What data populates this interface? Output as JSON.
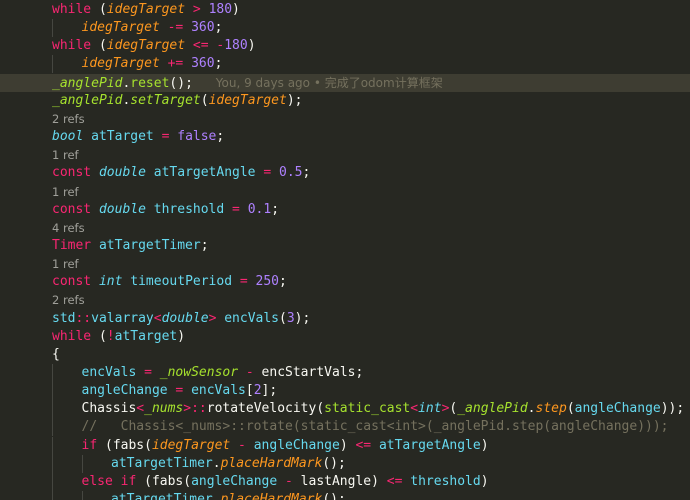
{
  "editor": {
    "lines": [
      {
        "indent": 0,
        "tokens": [
          [
            "kw",
            "while"
          ],
          [
            "p",
            " ("
          ],
          [
            "param",
            "idegTarget"
          ],
          [
            "op",
            " > "
          ],
          [
            "num",
            "180"
          ],
          [
            "p",
            ")"
          ]
        ]
      },
      {
        "indent": 1,
        "tokens": [
          [
            "param",
            "idegTarget"
          ],
          [
            "op",
            " -= "
          ],
          [
            "num",
            "360"
          ],
          [
            "p",
            ";"
          ]
        ]
      },
      {
        "indent": 0,
        "tokens": [
          [
            "kw",
            "while"
          ],
          [
            "p",
            " ("
          ],
          [
            "param",
            "idegTarget"
          ],
          [
            "op",
            " <= "
          ],
          [
            "op",
            "-"
          ],
          [
            "num",
            "180"
          ],
          [
            "p",
            ")"
          ]
        ]
      },
      {
        "indent": 1,
        "tokens": [
          [
            "param",
            "idegTarget"
          ],
          [
            "op",
            " += "
          ],
          [
            "num",
            "360"
          ],
          [
            "p",
            ";"
          ]
        ]
      },
      {
        "indent": 0,
        "current": true,
        "blame": "You, 9 days ago • 完成了odom计算框架",
        "tokens": [
          [
            "mem",
            "_anglePid"
          ],
          [
            "p",
            "."
          ],
          [
            "fn",
            "reset"
          ],
          [
            "p",
            "();"
          ]
        ]
      },
      {
        "indent": 0,
        "tokens": [
          [
            "mem",
            "_anglePid"
          ],
          [
            "p",
            "."
          ],
          [
            "mem",
            "setTarget"
          ],
          [
            "p",
            "("
          ],
          [
            "param",
            "idegTarget"
          ],
          [
            "p",
            ");"
          ]
        ]
      },
      {
        "indent": 0,
        "refs": "2 refs"
      },
      {
        "indent": 0,
        "tokens": [
          [
            "type",
            "bool"
          ],
          [
            "p",
            " "
          ],
          [
            "id",
            "atTarget"
          ],
          [
            "op",
            " = "
          ],
          [
            "num",
            "false"
          ],
          [
            "p",
            ";"
          ]
        ]
      },
      {
        "indent": 0,
        "refs": "1 ref"
      },
      {
        "indent": 0,
        "tokens": [
          [
            "kw",
            "const"
          ],
          [
            "p",
            " "
          ],
          [
            "type",
            "double"
          ],
          [
            "p",
            " "
          ],
          [
            "id",
            "atTargetAngle"
          ],
          [
            "op",
            " = "
          ],
          [
            "num",
            "0.5"
          ],
          [
            "p",
            ";"
          ]
        ]
      },
      {
        "indent": 0,
        "refs": "1 ref"
      },
      {
        "indent": 0,
        "tokens": [
          [
            "kw",
            "const"
          ],
          [
            "p",
            " "
          ],
          [
            "type",
            "double"
          ],
          [
            "p",
            " "
          ],
          [
            "id",
            "threshold"
          ],
          [
            "op",
            " = "
          ],
          [
            "num",
            "0.1"
          ],
          [
            "p",
            ";"
          ]
        ]
      },
      {
        "indent": 0,
        "refs": "4 refs"
      },
      {
        "indent": 0,
        "tokens": [
          [
            "kw",
            "Timer"
          ],
          [
            "p",
            " "
          ],
          [
            "id",
            "atTargetTimer"
          ],
          [
            "p",
            ";"
          ]
        ]
      },
      {
        "indent": 0,
        "refs": "1 ref"
      },
      {
        "indent": 0,
        "tokens": [
          [
            "kw",
            "const"
          ],
          [
            "p",
            " "
          ],
          [
            "type",
            "int"
          ],
          [
            "p",
            " "
          ],
          [
            "id",
            "timeoutPeriod"
          ],
          [
            "op",
            " = "
          ],
          [
            "num",
            "250"
          ],
          [
            "p",
            ";"
          ]
        ]
      },
      {
        "indent": 0,
        "refs": "2 refs"
      },
      {
        "indent": 0,
        "tokens": [
          [
            "cls",
            "std"
          ],
          [
            "op",
            "::"
          ],
          [
            "cls",
            "valarray"
          ],
          [
            "op",
            "<"
          ],
          [
            "type",
            "double"
          ],
          [
            "op",
            ">"
          ],
          [
            "p",
            " "
          ],
          [
            "id",
            "encVals"
          ],
          [
            "p",
            "("
          ],
          [
            "num",
            "3"
          ],
          [
            "p",
            ");"
          ]
        ]
      },
      {
        "indent": 0,
        "tokens": [
          [
            "kw",
            "while"
          ],
          [
            "p",
            " ("
          ],
          [
            "op",
            "!"
          ],
          [
            "id",
            "atTarget"
          ],
          [
            "p",
            ")"
          ]
        ]
      },
      {
        "indent": 0,
        "tokens": [
          [
            "p",
            "{"
          ]
        ]
      },
      {
        "indent": 1,
        "tokens": [
          [
            "id",
            "encVals"
          ],
          [
            "op",
            " = "
          ],
          [
            "mem",
            "_nowSensor"
          ],
          [
            "op",
            " - "
          ],
          [
            "var",
            "encStartVals"
          ],
          [
            "p",
            ";"
          ]
        ]
      },
      {
        "indent": 1,
        "tokens": [
          [
            "id",
            "angleChange"
          ],
          [
            "op",
            " = "
          ],
          [
            "id",
            "encVals"
          ],
          [
            "p",
            "["
          ],
          [
            "num",
            "2"
          ],
          [
            "p",
            "];"
          ]
        ]
      },
      {
        "indent": 1,
        "tokens": [
          [
            "p",
            "Chassis"
          ],
          [
            "op",
            "<"
          ],
          [
            "mem",
            "_nums"
          ],
          [
            "op",
            ">::"
          ],
          [
            "p",
            "rotateVelocity("
          ],
          [
            "fn",
            "static_cast"
          ],
          [
            "op",
            "<"
          ],
          [
            "type",
            "int"
          ],
          [
            "op",
            ">"
          ],
          [
            "p",
            "("
          ],
          [
            "mem",
            "_anglePid"
          ],
          [
            "p",
            "."
          ],
          [
            "fni",
            "step"
          ],
          [
            "p",
            "("
          ],
          [
            "id",
            "angleChange"
          ],
          [
            "p",
            "));"
          ]
        ]
      },
      {
        "indent": 1,
        "tokens": [
          [
            "cm",
            "//   Chassis<_nums>::rotate(static_cast<int>(_anglePid.step(angleChange)));"
          ]
        ]
      },
      {
        "indent": 1,
        "tokens": [
          [
            "kw",
            "if"
          ],
          [
            "p",
            " ("
          ],
          [
            "p",
            "fabs("
          ],
          [
            "param",
            "idegTarget"
          ],
          [
            "op",
            " - "
          ],
          [
            "id",
            "angleChange"
          ],
          [
            "p",
            ")"
          ],
          [
            "op",
            " <= "
          ],
          [
            "id",
            "atTargetAngle"
          ],
          [
            "p",
            ")"
          ]
        ]
      },
      {
        "indent": 2,
        "tokens": [
          [
            "id",
            "atTargetTimer"
          ],
          [
            "p",
            "."
          ],
          [
            "fni",
            "placeHardMark"
          ],
          [
            "p",
            "();"
          ]
        ]
      },
      {
        "indent": 1,
        "tokens": [
          [
            "kw",
            "else if"
          ],
          [
            "p",
            " ("
          ],
          [
            "p",
            "fabs("
          ],
          [
            "id",
            "angleChange"
          ],
          [
            "op",
            " - "
          ],
          [
            "var",
            "lastAngle"
          ],
          [
            "p",
            ")"
          ],
          [
            "op",
            " <= "
          ],
          [
            "id",
            "threshold"
          ],
          [
            "p",
            ")"
          ]
        ]
      },
      {
        "indent": 2,
        "tokens": [
          [
            "id",
            "atTargetTimer"
          ],
          [
            "p",
            "."
          ],
          [
            "fni",
            "placeHardMark"
          ],
          [
            "p",
            "();"
          ]
        ]
      }
    ]
  }
}
